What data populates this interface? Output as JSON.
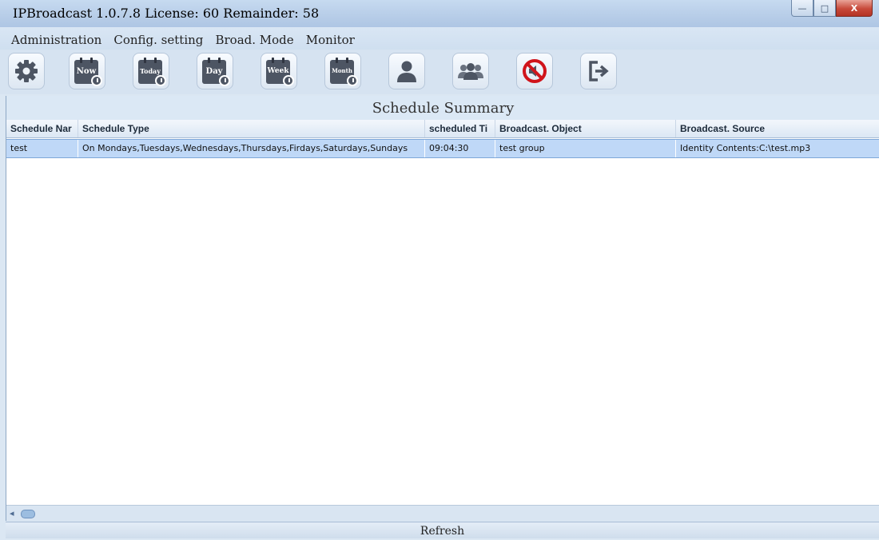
{
  "window": {
    "title": "IPBroadcast 1.0.7.8 License: 60 Remainder: 58",
    "controls": {
      "minimize": "—",
      "maximize": "□",
      "close": "X"
    }
  },
  "menu": {
    "items": [
      {
        "label": "Administration"
      },
      {
        "label": "Config. setting"
      },
      {
        "label": "Broad. Mode"
      },
      {
        "label": "Monitor"
      }
    ]
  },
  "toolbar": {
    "buttons": [
      {
        "name": "settings",
        "icon": "gear-icon"
      },
      {
        "name": "now",
        "icon": "calendar-clock-icon",
        "label": "Now"
      },
      {
        "name": "today",
        "icon": "calendar-clock-icon",
        "label": "Today"
      },
      {
        "name": "day",
        "icon": "calendar-clock-icon",
        "label": "Day"
      },
      {
        "name": "week",
        "icon": "calendar-clock-icon",
        "label": "Week"
      },
      {
        "name": "month",
        "icon": "calendar-clock-icon",
        "label": "Month"
      },
      {
        "name": "user",
        "icon": "user-icon"
      },
      {
        "name": "group",
        "icon": "group-icon"
      },
      {
        "name": "mute",
        "icon": "no-sound-icon"
      },
      {
        "name": "exit",
        "icon": "exit-icon"
      }
    ]
  },
  "summary": {
    "title": "Schedule Summary",
    "columns": [
      "Schedule Nar",
      "Schedule Type",
      "scheduled Ti",
      "Broadcast. Object",
      "Broadcast. Source"
    ],
    "rows": [
      [
        "test",
        "On Mondays,Tuesdays,Wednesdays,Thursdays,Firdays,Saturdays,Sundays",
        "09:04:30",
        "test group",
        "Identity Contents:C:\\test.mp3"
      ]
    ]
  },
  "footer": {
    "refresh_label": "Refresh"
  },
  "colors": {
    "accent": "#bfd8f7",
    "title_bar": "#b7cde8",
    "close": "#c7493a"
  }
}
